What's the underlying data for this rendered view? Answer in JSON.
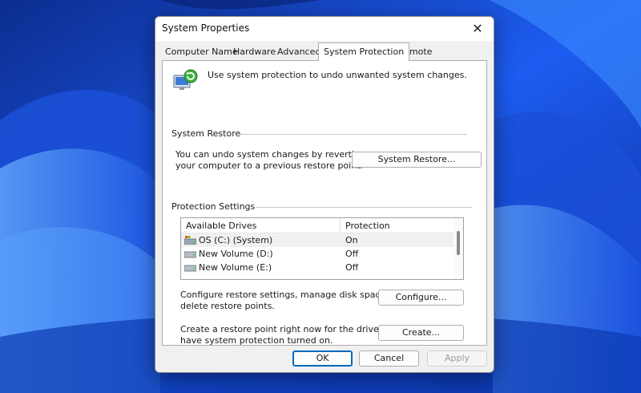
{
  "window": {
    "title": "System Properties",
    "close_glyph": "✕"
  },
  "tabs": [
    {
      "label": "Computer Name"
    },
    {
      "label": "Hardware"
    },
    {
      "label": "Advanced"
    },
    {
      "label": "System Protection",
      "active": true
    },
    {
      "label": "Remote"
    }
  ],
  "intro": {
    "text": "Use system protection to undo unwanted system changes.",
    "icon": "system-protection-icon"
  },
  "system_restore": {
    "group_label": "System Restore",
    "description_line1": "You can undo system changes by reverting",
    "description_line2": "your computer to a previous restore point.",
    "button_label": "System Restore..."
  },
  "protection_settings": {
    "group_label": "Protection Settings",
    "columns": {
      "drive": "Available Drives",
      "protection": "Protection"
    },
    "drives": [
      {
        "name": "OS (C:) (System)",
        "protection": "On",
        "icon": "system-drive-icon"
      },
      {
        "name": "New Volume (D:)",
        "protection": "Off",
        "icon": "drive-icon"
      },
      {
        "name": "New Volume (E:)",
        "protection": "Off",
        "icon": "drive-icon"
      }
    ],
    "configure_text_line1": "Configure restore settings, manage disk space, and",
    "configure_text_line2": "delete restore points.",
    "configure_button": "Configure...",
    "create_text_line1": "Create a restore point right now for the drives that",
    "create_text_line2": "have system protection turned on.",
    "create_button": "Create..."
  },
  "footer": {
    "ok": "OK",
    "cancel": "Cancel",
    "apply": "Apply"
  },
  "colors": {
    "accent": "#0067c0",
    "wallpaper": "#0a3fb8"
  }
}
